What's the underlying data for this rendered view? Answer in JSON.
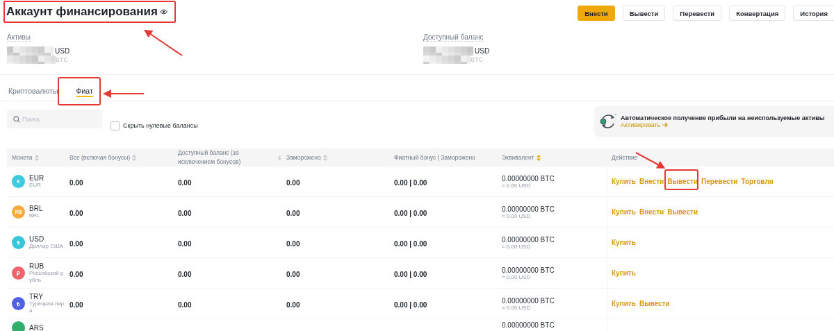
{
  "header": {
    "title": "Аккаунт финансирования",
    "buttons": [
      {
        "label": "Внести",
        "primary": true
      },
      {
        "label": "Вывести",
        "primary": false
      },
      {
        "label": "Перевести",
        "primary": false
      },
      {
        "label": "Конвертация",
        "primary": false
      },
      {
        "label": "История",
        "primary": false
      }
    ]
  },
  "balances": [
    {
      "label": "Активы",
      "currency": "USD",
      "btc": "BTC"
    },
    {
      "label": "Доступный баланс",
      "currency": "USD",
      "btc": "BTC"
    }
  ],
  "tabs": [
    {
      "label": "Криптовалюты",
      "selected": false
    },
    {
      "label": "Фиат",
      "selected": true
    }
  ],
  "search": {
    "placeholder": "Поиск"
  },
  "hide_zero": {
    "label": "Скрыть нулевые балансы",
    "checked": false
  },
  "promo": {
    "title": "Автоматическое получение прибыли на неиспользуемые активы",
    "link": "Активировать"
  },
  "table": {
    "columns": [
      {
        "label": "Монета",
        "sortable": true,
        "sort_active": false
      },
      {
        "label": "Все (включая бонусы)",
        "sortable": true,
        "sort_active": false
      },
      {
        "label": "Доступный баланс (за исключением бонусов)",
        "sortable": true,
        "sort_active": false
      },
      {
        "label": "Заморожено",
        "sortable": true,
        "sort_active": false
      },
      {
        "label": "Фиатный бонус | Заморожено",
        "sortable": false
      },
      {
        "label": "Эквивалент",
        "sortable": true,
        "sort_active": true
      },
      {
        "label": "Действие",
        "sortable": false
      }
    ],
    "rows": [
      {
        "symbol": "EUR",
        "name": "EUR",
        "glyph": "€",
        "color": "#3ccbdc",
        "total": "0.00",
        "available": "0.00",
        "frozen": "0.00",
        "bonus": "0.00 | 0.00",
        "btc": "0.00000000 BTC",
        "usd": "≈ 0.00 USD",
        "actions": [
          "Купить",
          "Внести",
          "Вывести",
          "Перевести",
          "Торговля"
        ]
      },
      {
        "symbol": "BRL",
        "name": "BRL",
        "glyph": "R$",
        "color": "#f8aa3c",
        "total": "0.00",
        "available": "0.00",
        "frozen": "0.00",
        "bonus": "0.00 | 0.00",
        "btc": "0.00000000 BTC",
        "usd": "≈ 0.00 USD",
        "actions": [
          "Купить",
          "Внести",
          "Вывести"
        ]
      },
      {
        "symbol": "USD",
        "name": "Доллар США",
        "glyph": "$",
        "color": "#36c6da",
        "total": "0.00",
        "available": "0.00",
        "frozen": "0.00",
        "bonus": "0.00 | 0.00",
        "btc": "0.00000000 BTC",
        "usd": "≈ 0.00 USD",
        "actions": [
          "Купить"
        ]
      },
      {
        "symbol": "RUB",
        "name": "Российский р убль",
        "glyph": "₽",
        "color": "#f0646c",
        "total": "0.00",
        "available": "0.00",
        "frozen": "0.00",
        "bonus": "0.00 | 0.00",
        "btc": "0.00000000 BTC",
        "usd": "≈ 0.00 USD",
        "actions": [
          "Купить"
        ]
      },
      {
        "symbol": "TRY",
        "name": "Турецкая лир а",
        "glyph": "₺",
        "color": "#4f62e6",
        "total": "0.00",
        "available": "0.00",
        "frozen": "0.00",
        "bonus": "0.00 | 0.00",
        "btc": "0.00000000 BTC",
        "usd": "≈ 0.00 USD",
        "actions": [
          "Купить",
          "Вывести"
        ]
      },
      {
        "symbol": "ARS",
        "color": "#2fae6c",
        "btc": "0.00000000 BTC"
      }
    ]
  }
}
